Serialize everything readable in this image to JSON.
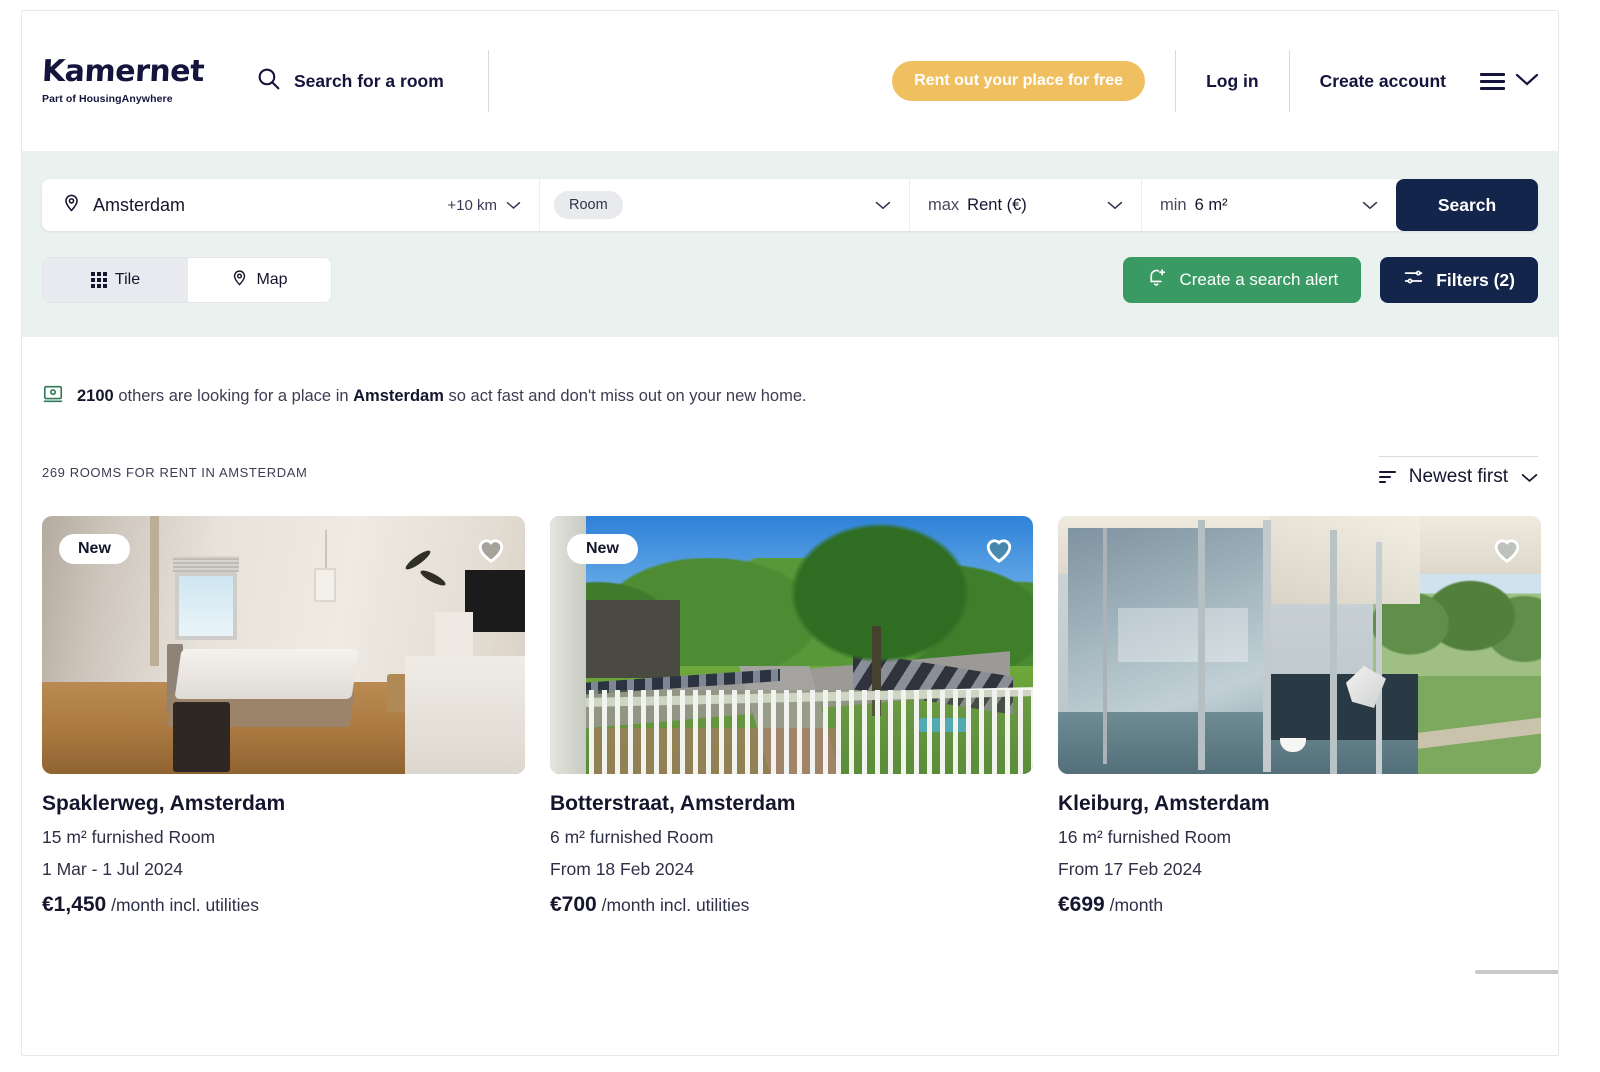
{
  "header": {
    "logo_word": "Kamernet",
    "logo_tagline": "Part of HousingAnywhere",
    "search_link_label": "Search for a room",
    "rent_out_label": "Rent out your place for free",
    "login_label": "Log in",
    "create_account_label": "Create account",
    "menu_icon": "hamburger-menu-icon",
    "chevron_icon": "chevron-down-icon"
  },
  "search": {
    "location_value": "Amsterdam",
    "location_icon": "map-pin-icon",
    "radius_value": "+10 km",
    "property_type_value": "Room",
    "rent_prefix": "max",
    "rent_label": "Rent (€)",
    "size_prefix": "min",
    "size_label": "6 m²",
    "search_button_label": "Search"
  },
  "tools": {
    "tile_label": "Tile",
    "map_label": "Map",
    "tile_icon": "grid-icon",
    "map_icon": "map-pin-icon",
    "alert_label": "Create a search alert",
    "alert_icon": "bell-plus-icon",
    "filters_label": "Filters (2)",
    "filters_icon": "sliders-icon"
  },
  "notice": {
    "icon": "people-looking-icon",
    "count": "2100",
    "text_before": "others are looking for a place in",
    "city": "Amsterdam",
    "text_after": "so act fast and don't miss out on your new home."
  },
  "results": {
    "count_label": "269 ROOMS FOR RENT IN AMSTERDAM",
    "sort_label": "Newest first",
    "sort_icon": "sort-icon",
    "sort_caret": "chevron-down-icon"
  },
  "listings": [
    {
      "badge": "New",
      "title": "Spaklerweg, Amsterdam",
      "meta": "15 m² furnished Room",
      "date": "1 Mar - 1 Jul 2024",
      "price": "€1,450",
      "price_suffix": "/month incl. utilities",
      "image_alt": "bedroom-photo",
      "favorite_icon": "heart-icon"
    },
    {
      "badge": "New",
      "title": "Botterstraat, Amsterdam",
      "meta": "6 m² furnished Room",
      "date": "From 18 Feb 2024",
      "price": "€700",
      "price_suffix": "/month incl. utilities",
      "image_alt": "balcony-view-photo",
      "favorite_icon": "heart-icon"
    },
    {
      "badge": "",
      "title": "Kleiburg, Amsterdam",
      "meta": "16 m² furnished Room",
      "date": "From 17 Feb 2024",
      "price": "€699",
      "price_suffix": "/month",
      "image_alt": "glass-balcony-photo",
      "favorite_icon": "heart-icon"
    }
  ],
  "colors": {
    "brand_navy": "#13254b",
    "accent_yellow": "#f0c060",
    "accent_green": "#3a9a63",
    "panel_bg": "#eaf2ef"
  }
}
